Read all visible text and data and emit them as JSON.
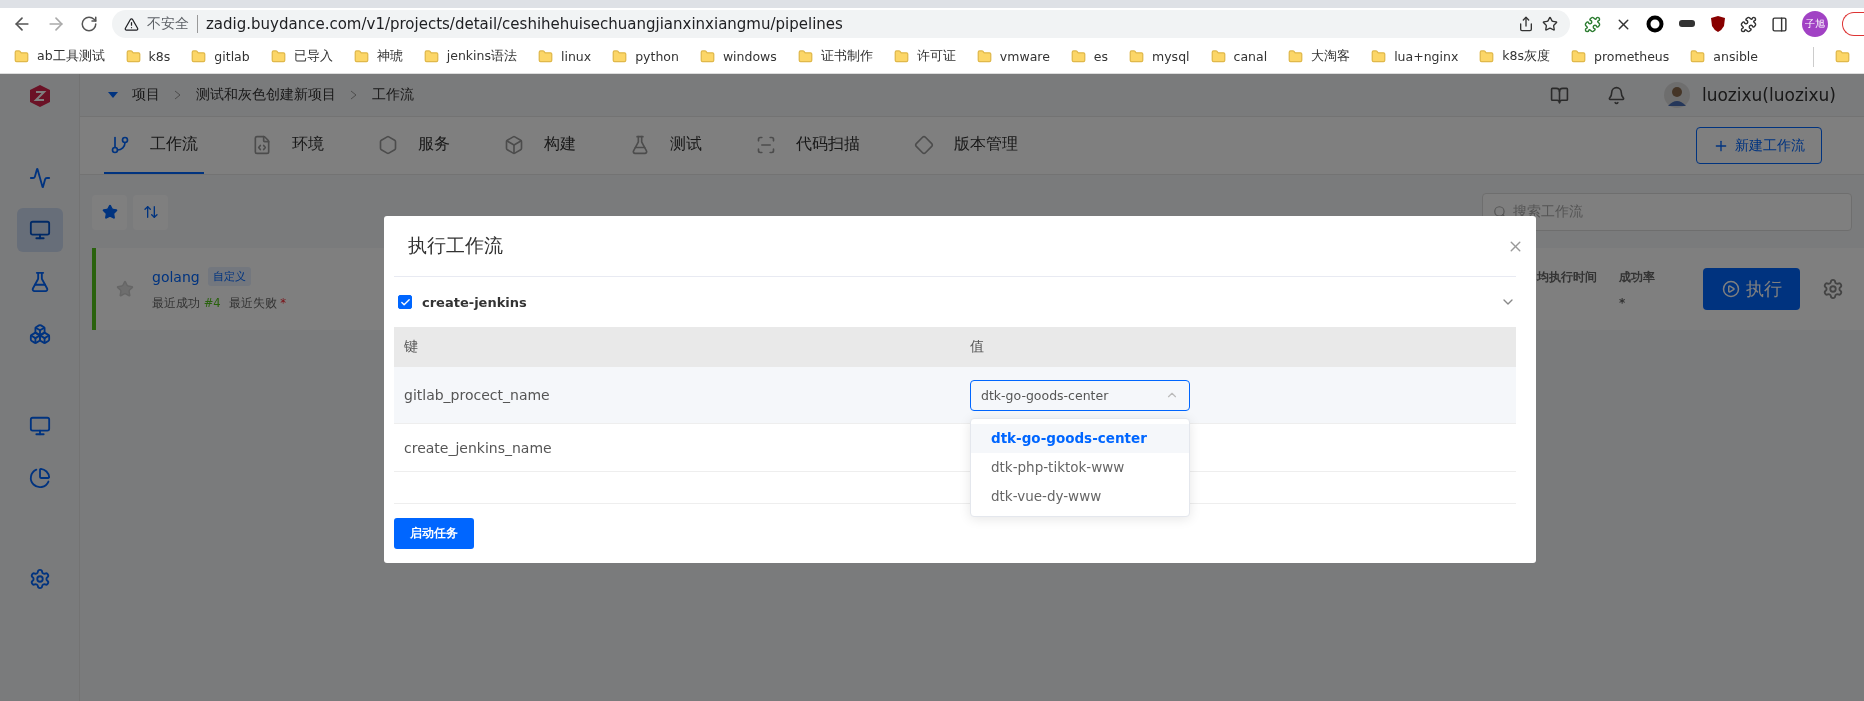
{
  "browser": {
    "insecure_label": "不安全",
    "url": "zadig.buydance.com/v1/projects/detail/ceshihehuisechuangjianxinxiangmu/pipelines",
    "profile": "子旭",
    "bookmarks": [
      "ab工具测试",
      "k8s",
      "gitlab",
      "已导入",
      "神琥",
      "jenkins语法",
      "linux",
      "python",
      "windows",
      "证书制作",
      "许可证",
      "vmware",
      "es",
      "mysql",
      "canal",
      "大淘客",
      "lua+nginx",
      "k8s灰度",
      "prometheus",
      "ansible"
    ]
  },
  "sidebar": {
    "items": [
      {
        "kind": "pulse",
        "selected": false
      },
      {
        "kind": "pm",
        "selected": true
      },
      {
        "kind": "flask",
        "selected": false
      },
      {
        "kind": "cube",
        "selected": false
      },
      {
        "kind": "monitor",
        "selected": false
      },
      {
        "kind": "pie",
        "selected": false
      }
    ]
  },
  "breadcrumb": [
    "项目",
    "测试和灰色创建新项目",
    "工作流"
  ],
  "user": {
    "name": "luozixu(luozixu)"
  },
  "tabs": [
    {
      "label": "工作流",
      "kind": "flow",
      "selected": true
    },
    {
      "label": "环境",
      "kind": "code",
      "selected": false
    },
    {
      "label": "服务",
      "kind": "service",
      "selected": false
    },
    {
      "label": "构建",
      "kind": "build",
      "selected": false
    },
    {
      "label": "测试",
      "kind": "test",
      "selected": false
    },
    {
      "label": "代码扫描",
      "kind": "scan",
      "selected": false
    },
    {
      "label": "版本管理",
      "kind": "version",
      "selected": false
    }
  ],
  "new_button": "新建工作流",
  "search": {
    "placeholder": "搜索工作流"
  },
  "workflow": {
    "name": "golang",
    "tag": "自定义",
    "last_success_label": "最近成功",
    "last_success": "#4",
    "last_fail_label": "最近失败",
    "last_fail": "*",
    "duration_label": "均执行时间",
    "rate_label": "成功率",
    "rate": "*",
    "run_button": "执行"
  },
  "dialog": {
    "title": "执行工作流",
    "job": {
      "name": "create-jenkins",
      "checked": true,
      "expanded": true
    },
    "columns": [
      "键",
      "值"
    ],
    "rows": [
      {
        "key": "gitlab_procect_name",
        "value": "dtk-go-goods-center",
        "open": true
      },
      {
        "key": "create_jenkins_name"
      }
    ],
    "options": [
      {
        "label": "dtk-go-goods-center",
        "selected": true
      },
      {
        "label": "dtk-php-tiktok-www",
        "selected": false
      },
      {
        "label": "dtk-vue-dy-www",
        "selected": false
      }
    ],
    "submit": "启动任务"
  }
}
